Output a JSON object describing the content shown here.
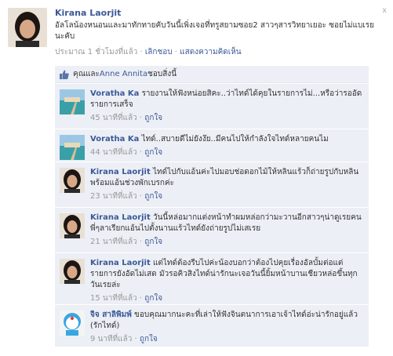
{
  "post": {
    "author": "Kirana Laorjit",
    "message": "อัลโลน้องหนอนและมาทักทายคับวันนี้เพิ่งเจอที่ทรูสยามซอย2 สาวๆสารวิทยาเยอะ ซอยไม่แบเรยนะคับ",
    "time": "ประมาณ 1 ชั่วโมงที่แล้ว",
    "sep": " · ",
    "unlike": "เลิกชอบ",
    "comment_action": "แสดงความคิดเห็น"
  },
  "likes": {
    "you_and": "คุณและ ",
    "name": "Anne Annita",
    "suffix": " ชอบสิ่งนี้"
  },
  "comments": [
    {
      "author": "Voratha Ka",
      "text": "รายงานให้ฟังหน่อยสิคะ..ว่าไทด์ได้คุยในรายการไม่...หรือว่ารออัดรายการเสร็จ",
      "time": "45 นาทีที่แล้ว",
      "like": "ถูกใจ"
    },
    {
      "author": "Voratha Ka",
      "text": "ไทด์..สบายดีไม่ยังง๊ย..มีคนไปให้กำลังใจไทด์หลายคนไม",
      "time": "44 นาทีที่แล้ว",
      "like": "ถูกใจ"
    },
    {
      "author": "Kirana Laorjit",
      "text": "ไทด์ไปกับแอ้นค่ะไปมอบช่อดอกไม้ให้หลินแร้วก็ถ่ายรูปกับหลินพร้อมแอ้นช่วงพักเบรกค่ะ",
      "time": "23 นาทีที่แล้ว",
      "like": "ถูกใจ"
    },
    {
      "author": "Kirana Laorjit",
      "text": "วันนี้หล่อมากแต่งหน้าทำผมหล่อกว่ามะวานอีกสาวๆน่าดูเรยคนพี่ๆลาเรียกแอ้นไปตั้งนานแร้วไทด์ยังถ่ายรูปไม่เสเรย",
      "time": "21 นาทีที่แล้ว",
      "like": "ถูกใจ"
    },
    {
      "author": "Kirana Laorjit",
      "text": "แต่ไทด์ต้องรีบไปค่ะน้องบอกว่าต้องไปคุยเรื่องอัลบั้มต่อแต่รายการยังอัดไม่เสด มัวรอคิวสิงไทด์น่ารักนะเจอวันนี้ยิ้มหน้าบานเชียวหล่อขึ้นทุกวันเรยล่ะ",
      "time": "15 นาทีที่แล้ว",
      "like": "ถูกใจ"
    },
    {
      "author": "จิจ สาลิพิมพ์",
      "text": "ขอบคุณมากนะคะที่เล่าให้ฟังจินตนาการเอาเจ้าไทด์อ่ะน่ารักอยู่แล้ว (รักไทด์)",
      "time": "9 นาทีที่แล้ว",
      "like": "ถูกใจ"
    }
  ],
  "close_label": "x",
  "colors": {
    "link": "#3b5998",
    "panel": "#eceff5",
    "meta": "#999999"
  }
}
